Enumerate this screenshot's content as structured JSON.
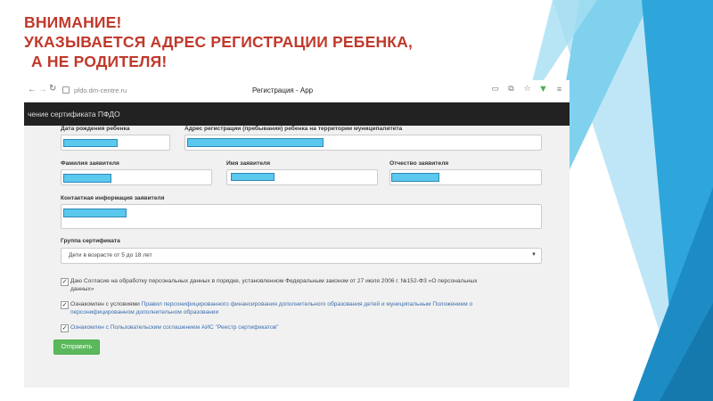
{
  "slide": {
    "title_line1": "ВНИМАНИЕ!",
    "title_line2": "УКАЗЫВАЕТСЯ АДРЕС РЕГИСТРАЦИИ РЕБЕНКА,",
    "title_line3": " А НЕ РОДИТЕЛЯ!"
  },
  "browser": {
    "url": "pfdo.dm-centre.ru",
    "tab_title": "Регистрация - App"
  },
  "app": {
    "header": "чение сертификата ПФДО"
  },
  "form": {
    "birth_date_label": "Дата рождения ребенка",
    "address_label": "Адрес регистрации (пребывания) ребенка на территории муниципалитета",
    "last_name_label": "Фамилия заявителя",
    "first_name_label": "Имя заявителя",
    "patronymic_label": "Отчество заявителя",
    "contact_label": "Контактная информация заявителя",
    "group_label": "Группа сертификата",
    "group_value": "Дети в возрасте от 5 до 18 лет",
    "consent_text": "Даю Согласие на обработку персональных данных в порядке, установленном Федеральным законом от 27 июля 2006 г. №152-ФЗ «О персональных",
    "consent_text_2": "данных»",
    "rules_prefix": "Ознакомлен с условиями ",
    "rules_link": "Правил персонифицированного финансирования дополнительного образования детей и муниципальным Положением о",
    "rules_link_2": "персонифицированном дополнительном образовании",
    "agreement_text": "Ознакомлен с Пользовательским соглашением АИС \"Реестр сертификатов\"",
    "submit_label": "Отправить"
  },
  "colors": {
    "title": "#c0392b",
    "redaction": "#5bc8ee",
    "appbar": "#222222",
    "submit": "#5cb85c"
  }
}
